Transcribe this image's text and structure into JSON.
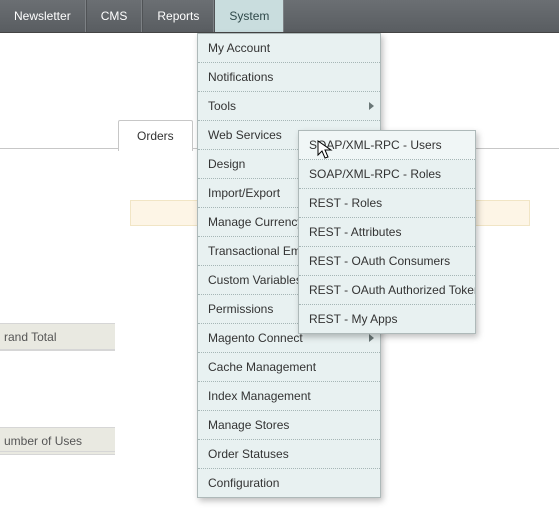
{
  "topbar": {
    "items": [
      "Newsletter",
      "CMS",
      "Reports",
      "System"
    ],
    "active_index": 3
  },
  "tab": {
    "label": "Orders"
  },
  "side_labels": {
    "grand_total": "rand Total",
    "number_of_uses": "umber of Uses"
  },
  "dropdown": {
    "items": [
      {
        "label": "My Account"
      },
      {
        "label": "Notifications"
      },
      {
        "label": "Tools",
        "has_sub": true
      },
      {
        "label": "Web Services",
        "has_sub": true
      },
      {
        "label": "Design"
      },
      {
        "label": "Import/Export",
        "has_sub": true
      },
      {
        "label": "Manage Currency",
        "has_sub": true
      },
      {
        "label": "Transactional Emails"
      },
      {
        "label": "Custom Variables"
      },
      {
        "label": "Permissions",
        "has_sub": true
      },
      {
        "label": "Magento Connect",
        "has_sub": true
      },
      {
        "label": "Cache Management"
      },
      {
        "label": "Index Management"
      },
      {
        "label": "Manage Stores"
      },
      {
        "label": "Order Statuses"
      },
      {
        "label": "Configuration"
      }
    ]
  },
  "submenu": {
    "items": [
      {
        "label": "SOAP/XML-RPC - Users",
        "highlight": true
      },
      {
        "label": "SOAP/XML-RPC - Roles"
      },
      {
        "label": "REST - Roles"
      },
      {
        "label": "REST - Attributes"
      },
      {
        "label": "REST - OAuth Consumers"
      },
      {
        "label": "REST - OAuth Authorized Tokens"
      },
      {
        "label": "REST - My Apps"
      }
    ]
  }
}
